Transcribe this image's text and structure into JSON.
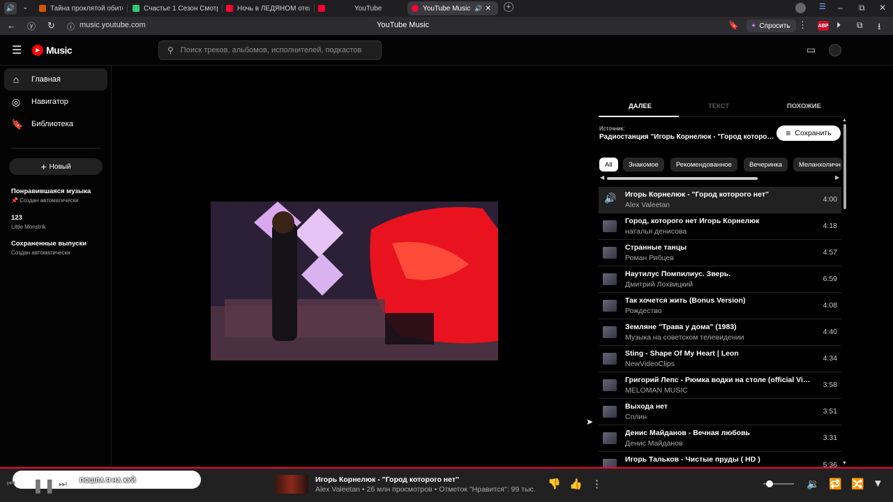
{
  "browser": {
    "tabs": [
      {
        "label": "Тайна проклятой обител",
        "color": "#d35400"
      },
      {
        "label": "Счастье 1 Сезон Смотре",
        "color": "#2ecc71"
      },
      {
        "label": "Ночь в ЛЕДЯНОМ отеле",
        "color": "#ff0033"
      },
      {
        "label": "YouTube",
        "color": "#ff0033"
      },
      {
        "label": "YouTube Music",
        "color": "#ff0033"
      }
    ],
    "url": "music.youtube.com",
    "page_title": "YouTube Music",
    "ask_label": "Спросить",
    "abp_label": "ABP"
  },
  "header": {
    "logo": "Music",
    "search_placeholder": "Поиск треков, альбомов, исполнителей, подкастов"
  },
  "sidebar": {
    "nav": [
      {
        "label": "Главная",
        "icon": "home-icon"
      },
      {
        "label": "Навигатор",
        "icon": "compass-icon"
      },
      {
        "label": "Библиотека",
        "icon": "library-icon"
      }
    ],
    "new_label": "Новый",
    "playlists": [
      {
        "title": "Понравившаяся музыка",
        "subtitle": "📌 Создан автоматически"
      },
      {
        "title": "123",
        "subtitle": "Little Monstrik"
      },
      {
        "title": "Сохраненные выпуски",
        "subtitle": "Создан автоматически"
      }
    ]
  },
  "panel": {
    "tabs": [
      "ДАЛЕЕ",
      "ТЕКСТ",
      "ПОХОЖИЕ"
    ],
    "source_label": "Источник:",
    "source_value": "Радиостанция \"Игорь Корнелюк - \"Город которого нет\"\"",
    "save_label": "Сохранить",
    "chips": [
      "All",
      "Знакомое",
      "Рекомендованное",
      "Вечеринка",
      "Меланхоличн"
    ],
    "queue": [
      {
        "title": "Игорь Корнелюк - \"Город которого нет\"",
        "artist": "Alex Valeetan",
        "duration": "4:00"
      },
      {
        "title": "Город, которого нет Игорь Корнелюк",
        "artist": "наталья денисова",
        "duration": "4:18"
      },
      {
        "title": "Странные танцы",
        "artist": "Роман Рябцев",
        "duration": "4:57"
      },
      {
        "title": "Наутилус Помпилиус. Зверь.",
        "artist": "Дмитрий Лохвицкий",
        "duration": "6:59"
      },
      {
        "title": "Так хочется жить (Bonus Version)",
        "artist": "Рождество",
        "duration": "4:08"
      },
      {
        "title": "Земляне \"Трава у дома\" (1983)",
        "artist": "Музыка на советском телевидении",
        "duration": "4:40"
      },
      {
        "title": "Sting - Shape Of My Heart | Leon",
        "artist": "NewVideoClips",
        "duration": "4:34"
      },
      {
        "title": "Григорий Лепс - Рюмка водки на столе (official Video)",
        "artist": "MELOMAN MUSIC",
        "duration": "3:58"
      },
      {
        "title": "Выхода нет",
        "artist": "Сплин",
        "duration": "3:51"
      },
      {
        "title": "Денис Майданов - Вечная любовь",
        "artist": "Денис Майданов",
        "duration": "3:31"
      },
      {
        "title": "Игорь Тальков - Чистые пруды ( HD )",
        "artist": "",
        "duration": "5:36"
      }
    ]
  },
  "player": {
    "lyric": "ПОШЛА Я НА ХУЙ",
    "title": "Игорь Корнелюк - \"Город которого нет\"",
    "meta": "Alex Valeetan • 26 млн просмотров • Отметок \"Нравится\": 99 тыс.",
    "volume_fraction": 0.2
  }
}
